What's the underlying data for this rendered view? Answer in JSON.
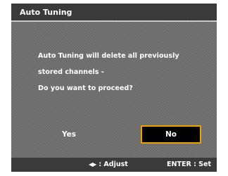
{
  "dialog": {
    "title": "Auto Tuning",
    "message_lines": [
      "Auto Tuning will delete all previously",
      "stored channels -",
      "Do you want to proceed?"
    ],
    "buttons": {
      "yes_label": "Yes",
      "no_label": "No",
      "selected": "No"
    }
  },
  "footer": {
    "adjust_icon": "left-right-arrows-icon",
    "adjust_glyph": "◀▶",
    "adjust_label": ": Adjust",
    "enter_label": "ENTER : Set"
  },
  "colors": {
    "title_bar": "#3a3a3a",
    "panel": "#6f6f6f",
    "focus_border": "#e9a200",
    "text": "#ffffff"
  }
}
